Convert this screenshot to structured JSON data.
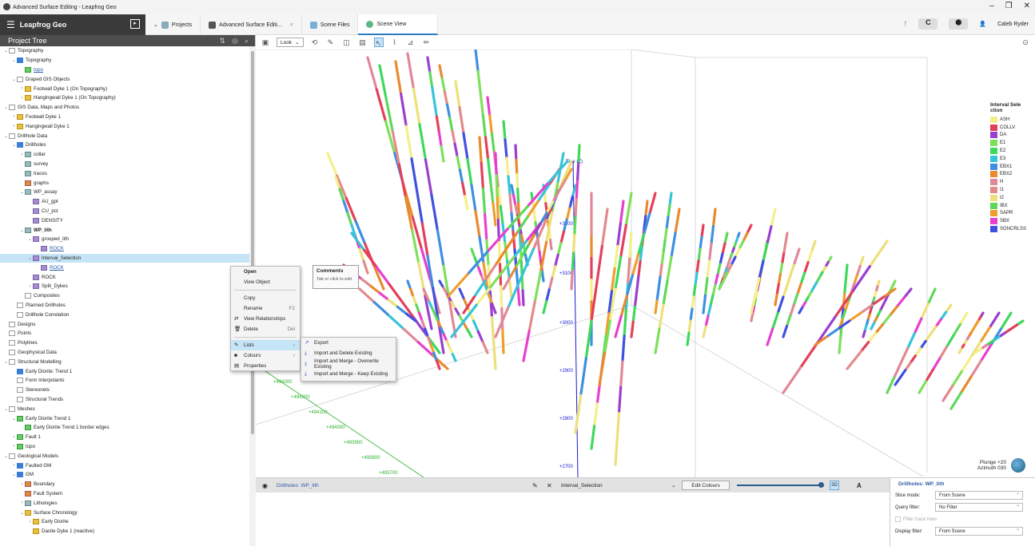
{
  "window": {
    "title": "Advanced Surface Editing - Leapfrog Geo",
    "controls": [
      "–",
      "❐",
      "✕"
    ]
  },
  "app": {
    "brand": "Leapfrog Geo",
    "tabs": [
      {
        "label": "Projects",
        "active": false
      },
      {
        "label": "Advanced Surface Editi...",
        "active": false,
        "closable": "×"
      },
      {
        "label": "Scene Files",
        "active": false
      },
      {
        "label": "Scene View",
        "active": true
      }
    ],
    "user": "Caleb Ryder",
    "colors": {
      "header": "#3a3a3a",
      "accent": "#2e7cc0"
    }
  },
  "project_tree": {
    "title": "Project Tree",
    "items": [
      {
        "label": "Topography",
        "level": 0,
        "open": true,
        "icon": "folder"
      },
      {
        "label": "Topography",
        "level": 1,
        "open": true,
        "icon": "blue"
      },
      {
        "label": "topo",
        "level": 2,
        "icon": "green",
        "link": true
      },
      {
        "label": "Draped GIS Objects",
        "level": 1,
        "open": true,
        "icon": "folder"
      },
      {
        "label": "Footwall Dyke 1 (On Topography)",
        "level": 2,
        "open": false,
        "icon": "yellow"
      },
      {
        "label": "Hangingwall Dyke 1 (On Topography)",
        "level": 2,
        "open": false,
        "icon": "yellow"
      },
      {
        "label": "GIS Data, Maps and Photos",
        "level": 0,
        "open": true,
        "icon": "folder"
      },
      {
        "label": "Footwall Dyke 1",
        "level": 1,
        "open": false,
        "icon": "yellow"
      },
      {
        "label": "Hangingwall Dyke 1",
        "level": 1,
        "open": false,
        "icon": "yellow"
      },
      {
        "label": "Drillhole Data",
        "level": 0,
        "open": true,
        "icon": "folder"
      },
      {
        "label": "Drillholes",
        "level": 1,
        "open": true,
        "icon": "blue"
      },
      {
        "label": "collar",
        "level": 2,
        "open": false,
        "icon": "grid"
      },
      {
        "label": "survey",
        "level": 2,
        "icon": "grid"
      },
      {
        "label": "traces",
        "level": 2,
        "icon": "grid"
      },
      {
        "label": "graphs",
        "level": 2,
        "icon": "orange"
      },
      {
        "label": "WP_assay",
        "level": 2,
        "open": true,
        "icon": "grid"
      },
      {
        "label": "AU_gpt",
        "level": 3,
        "icon": "purple"
      },
      {
        "label": "CU_pct",
        "level": 3,
        "icon": "purple"
      },
      {
        "label": "DENSITY",
        "level": 3,
        "icon": "purple"
      },
      {
        "label": "WP_lith",
        "level": 2,
        "open": true,
        "icon": "grid",
        "bold": true
      },
      {
        "label": "grouped_lith",
        "level": 3,
        "open": true,
        "icon": "purple"
      },
      {
        "label": "ROCK",
        "level": 4,
        "icon": "purple",
        "link": true
      },
      {
        "label": "Interval_Selection",
        "level": 3,
        "open": true,
        "icon": "purple",
        "selected": true
      },
      {
        "label": "ROCK",
        "level": 4,
        "icon": "purple",
        "link": true
      },
      {
        "label": "ROCK",
        "level": 3,
        "icon": "purple"
      },
      {
        "label": "Split_Dykes",
        "level": 3,
        "open": false,
        "icon": "purple"
      },
      {
        "label": "Composites",
        "level": 2,
        "icon": "folder"
      },
      {
        "label": "Planned Drillholes",
        "level": 1,
        "icon": "folder"
      },
      {
        "label": "Drillhole Correlation",
        "level": 1,
        "icon": "folder"
      },
      {
        "label": "Designs",
        "level": 0,
        "icon": "folder"
      },
      {
        "label": "Points",
        "level": 0,
        "icon": "folder"
      },
      {
        "label": "Polylines",
        "level": 0,
        "icon": "folder"
      },
      {
        "label": "Geophysical Data",
        "level": 0,
        "icon": "folder"
      },
      {
        "label": "Structural Modelling",
        "level": 0,
        "open": true,
        "icon": "folder"
      },
      {
        "label": "Early Diorite: Trend 1",
        "level": 1,
        "icon": "blue"
      },
      {
        "label": "Form Interpolants",
        "level": 1,
        "icon": "folder"
      },
      {
        "label": "Stereonets",
        "level": 1,
        "icon": "folder"
      },
      {
        "label": "Structural Trends",
        "level": 1,
        "icon": "folder"
      },
      {
        "label": "Meshes",
        "level": 0,
        "open": true,
        "icon": "folder"
      },
      {
        "label": "Early Diorite Trend 1",
        "level": 1,
        "open": true,
        "icon": "green"
      },
      {
        "label": "Early Diorite Trend 1 border edges",
        "level": 2,
        "icon": "green"
      },
      {
        "label": "Fault 1",
        "level": 1,
        "open": false,
        "icon": "green"
      },
      {
        "label": "topo",
        "level": 1,
        "open": false,
        "icon": "green"
      },
      {
        "label": "Geological Models",
        "level": 0,
        "open": true,
        "icon": "folder"
      },
      {
        "label": "Faulted GM",
        "level": 1,
        "open": false,
        "icon": "blue"
      },
      {
        "label": "GM",
        "level": 1,
        "open": true,
        "icon": "blue"
      },
      {
        "label": "Boundary",
        "level": 2,
        "open": false,
        "icon": "orange"
      },
      {
        "label": "Fault System",
        "level": 2,
        "icon": "orange"
      },
      {
        "label": "Lithologies",
        "level": 2,
        "open": false,
        "icon": "grid"
      },
      {
        "label": "Surface Chronology",
        "level": 2,
        "open": true,
        "icon": "yellow"
      },
      {
        "label": "Early Diorite",
        "level": 3,
        "open": false,
        "icon": "yellow"
      },
      {
        "label": "Dacite Dyke 1 (reactive)",
        "level": 3,
        "icon": "yellow"
      }
    ]
  },
  "scene_toolbar": {
    "look": "Look"
  },
  "legend": {
    "title": "Interval Sele ction",
    "items": [
      {
        "label": "ASH",
        "color": "#f4ef8a"
      },
      {
        "label": "COLLV",
        "color": "#e43f5a"
      },
      {
        "label": "DA",
        "color": "#9a3fd0"
      },
      {
        "label": "E1",
        "color": "#7ee05a"
      },
      {
        "label": "E2",
        "color": "#3ed85c"
      },
      {
        "label": "E3",
        "color": "#36c4d8"
      },
      {
        "label": "EBX1",
        "color": "#3e8fe0"
      },
      {
        "label": "EBX2",
        "color": "#e88a2e"
      },
      {
        "label": "H",
        "color": "#e0889a"
      },
      {
        "label": "I1",
        "color": "#e38a8a"
      },
      {
        "label": "I2",
        "color": "#ece07a"
      },
      {
        "label": "IBX",
        "color": "#5fd85a"
      },
      {
        "label": "SAPR",
        "color": "#ef9e2e"
      },
      {
        "label": "SBX",
        "color": "#e83fd0"
      },
      {
        "label": "SGNCRLSS",
        "color": "#4050e0"
      }
    ]
  },
  "axes": {
    "elev_label": "Elev (Z)",
    "elevations": [
      "+3200",
      "+3100",
      "+3000",
      "+2900",
      "+2800",
      "+2700"
    ],
    "northings": [
      "+494300",
      "+494200",
      "+494100",
      "+494000",
      "+493900",
      "+493800",
      "+493700"
    ]
  },
  "compass": {
    "plunge": "Plunge +20",
    "azimuth": "Azimuth 030"
  },
  "context_menu": {
    "items": [
      {
        "label": "Open",
        "bold": true
      },
      {
        "label": "View Object"
      },
      {
        "sep": true
      },
      {
        "label": "Copy"
      },
      {
        "label": "Rename",
        "shortcut": "F2"
      },
      {
        "label": "View Relationships",
        "icon": "⇄"
      },
      {
        "label": "Delete",
        "shortcut": "Del",
        "icon": "🗑"
      },
      {
        "sep": true
      },
      {
        "label": "Lists",
        "icon": "✎",
        "arrow": "›",
        "highlight": true
      },
      {
        "label": "Colours",
        "icon": "■",
        "arrow": "›"
      },
      {
        "label": "Properties",
        "icon": "▤"
      }
    ]
  },
  "submenu": {
    "items": [
      {
        "label": "Export",
        "icon": "↗"
      },
      {
        "label": "Import and Delete Existing",
        "icon": "⤓"
      },
      {
        "label": "Import and Merge - Overwrite Existing",
        "icon": "⤓"
      },
      {
        "label": "Import and Merge - Keep Existing",
        "icon": "⤓"
      }
    ]
  },
  "tooltip": {
    "title": "Comments",
    "body": "Tab or click to edit"
  },
  "shape_bar": {
    "name": "Drillholes: WP_lith",
    "colouring": "Interval_Selection",
    "edit_colours": "Edit Colours",
    "btn3d": "3D"
  },
  "properties": {
    "title": "Drillholes: WP_lith",
    "rows": [
      {
        "label": "Slice mode:",
        "value": "From Scene"
      },
      {
        "label": "Query filter:",
        "value": "No Filter"
      },
      {
        "label": "Filter trace lines",
        "disabled": true
      },
      {
        "label": "Display filter:",
        "value": "From Scene"
      }
    ]
  }
}
